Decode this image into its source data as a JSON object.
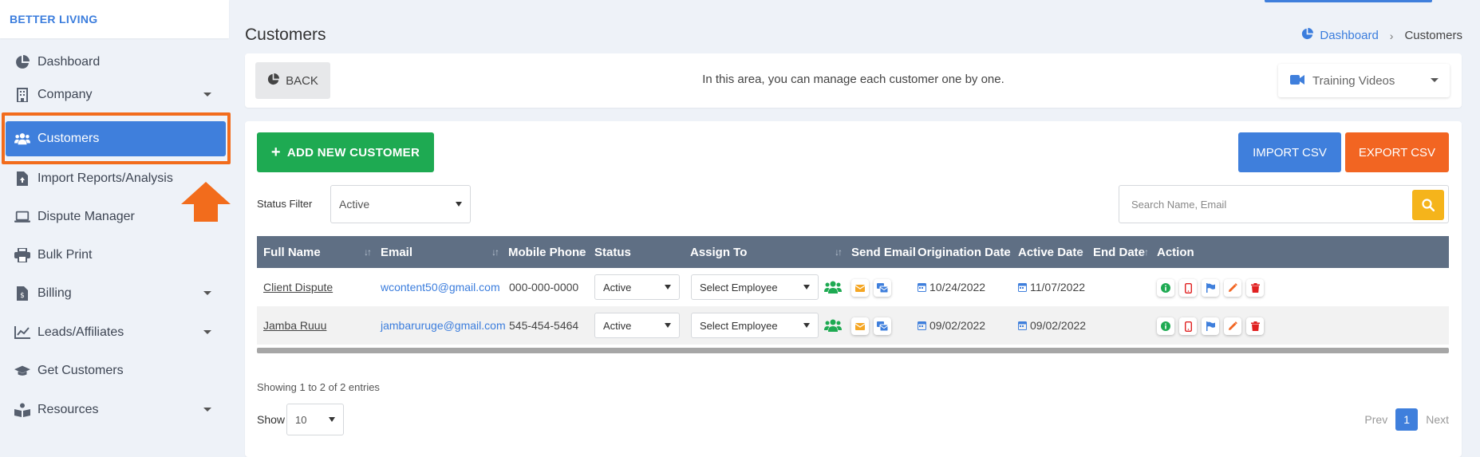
{
  "brand": "BETTER LIVING",
  "sidebar": {
    "items": [
      {
        "label": "Dashboard",
        "icon": "pie-chart-icon"
      },
      {
        "label": "Company",
        "icon": "building-icon"
      },
      {
        "label": "Customers",
        "icon": "users-icon"
      },
      {
        "label": "Import Reports/Analysis",
        "icon": "file-upload-icon"
      },
      {
        "label": "Dispute Manager",
        "icon": "laptop-icon"
      },
      {
        "label": "Bulk Print",
        "icon": "printer-icon"
      },
      {
        "label": "Billing",
        "icon": "invoice-icon"
      },
      {
        "label": "Leads/Affiliates",
        "icon": "line-chart-icon"
      },
      {
        "label": "Get Customers",
        "icon": "graduation-cap-icon"
      },
      {
        "label": "Resources",
        "icon": "book-reader-icon"
      }
    ]
  },
  "header": {
    "title": "Customers",
    "breadcrumb": {
      "home": "Dashboard",
      "current": "Customers"
    }
  },
  "topbar": {
    "back_label": "BACK",
    "info": "In this area, you can manage each customer one by one.",
    "training_label": "Training Videos"
  },
  "actions": {
    "add_label": "ADD NEW CUSTOMER",
    "import_label": "IMPORT CSV",
    "export_label": "EXPORT CSV"
  },
  "filter": {
    "label": "Status Filter",
    "value": "Active",
    "search_placeholder": "Search Name, Email"
  },
  "table": {
    "columns": [
      "Full Name",
      "Email",
      "Mobile Phone",
      "Status",
      "Assign To",
      "Send Email",
      "Origination Date",
      "Active Date",
      "End Date",
      "Action"
    ],
    "rows": [
      {
        "name": "Client Dispute",
        "email": "wcontent50@gmail.com",
        "phone": "000-000-0000",
        "status": "Active",
        "assign": "Select Employee",
        "origination": "10/24/2022",
        "active": "11/07/2022",
        "end": ""
      },
      {
        "name": "Jamba Ruuu",
        "email": "jambaruruge@gmail.com",
        "phone": "545-454-5464",
        "status": "Active",
        "assign": "Select Employee",
        "origination": "09/02/2022",
        "active": "09/02/2022",
        "end": ""
      }
    ]
  },
  "footer": {
    "showing": "Showing 1 to 2 of 2 entries",
    "show_label": "Show",
    "page_size": "10",
    "prev": "Prev",
    "page": "1",
    "next": "Next"
  },
  "colors": {
    "primary": "#3f7fdc",
    "success": "#1eaa52",
    "orange": "#f26522",
    "warning": "#f5b41b",
    "danger": "#e02020",
    "header_bg": "#5f6f84"
  }
}
